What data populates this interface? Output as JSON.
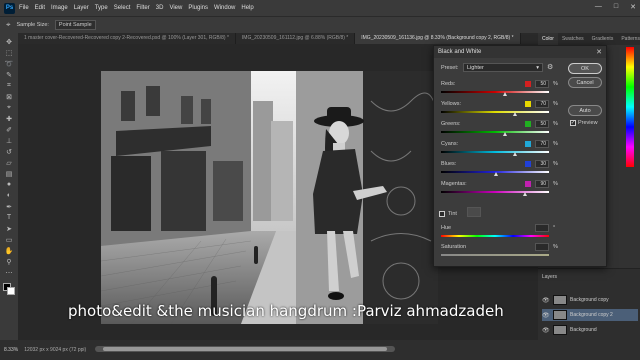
{
  "app": {
    "logo": "Ps"
  },
  "menu": [
    "File",
    "Edit",
    "Image",
    "Layer",
    "Type",
    "Select",
    "Filter",
    "3D",
    "View",
    "Plugins",
    "Window",
    "Help"
  ],
  "window_controls": [
    "—",
    "□",
    "✕"
  ],
  "options_bar": {
    "sample_size_label": "Sample Size:",
    "sample_size_value": "Point Sample"
  },
  "doc_tabs": [
    "1 master cover-Recovered-Recovered copy 2-Recovered.psd @ 100% (Layer 301, RGB/8) *",
    "IMG_20230509_161112.jpg @ 6.88% (RGB/8) *",
    "IMG_20230509_161136.jpg @ 8.33% (Background copy 2, RGB/8) *"
  ],
  "tools": [
    "move",
    "marquee",
    "lasso",
    "quick-select",
    "crop",
    "frame",
    "eyedropper",
    "heal",
    "brush",
    "stamp",
    "history",
    "eraser",
    "gradient",
    "blur",
    "dodge",
    "pen",
    "type",
    "path-select",
    "shape",
    "hand",
    "zoom",
    "more"
  ],
  "right_panel": {
    "tabs": [
      "Color",
      "Swatches",
      "Gradients",
      "Patterns"
    ]
  },
  "dialog": {
    "title": "Black and White",
    "close": "✕",
    "preset_label": "Preset:",
    "preset_value": "Lighter",
    "ok": "OK",
    "cancel": "Cancel",
    "auto": "Auto",
    "preview_label": "Preview",
    "preview_checked": "✓",
    "pct": "%",
    "sliders": [
      {
        "label": "Reds:",
        "value": "50",
        "color": "#d42020",
        "gradient": "linear-gradient(90deg,#000,#c00,#fff)",
        "pos": 0.6
      },
      {
        "label": "Yellows:",
        "value": "70",
        "color": "#e8d800",
        "gradient": "linear-gradient(90deg,#000,#dd0,#fff)",
        "pos": 0.69
      },
      {
        "label": "Greens:",
        "value": "50",
        "color": "#20b020",
        "gradient": "linear-gradient(90deg,#000,#0b0,#fff)",
        "pos": 0.6
      },
      {
        "label": "Cyans:",
        "value": "70",
        "color": "#20a8d8",
        "gradient": "linear-gradient(90deg,#000,#0bd,#fff)",
        "pos": 0.69
      },
      {
        "label": "Blues:",
        "value": "30",
        "color": "#2040d8",
        "gradient": "linear-gradient(90deg,#000,#22d,#fff)",
        "pos": 0.51
      },
      {
        "label": "Magentas:",
        "value": "90",
        "color": "#c020b0",
        "gradient": "linear-gradient(90deg,#000,#c0b,#fff)",
        "pos": 0.78
      }
    ],
    "tint_label": "Tint",
    "hue_label": "Hue",
    "hue_unit": "°",
    "saturation_label": "Saturation"
  },
  "layers": {
    "tab": "Layers",
    "rows": [
      {
        "name": "Background copy",
        "selected": false
      },
      {
        "name": "Background copy 2",
        "selected": true
      },
      {
        "name": "Background",
        "selected": false
      }
    ]
  },
  "status": {
    "zoom": "8.33%",
    "doc_info": "12032 px x 9024 px (72 ppi)"
  },
  "caption": "photo&edit &the musician hangdrum :Parviz ahmadzadeh"
}
